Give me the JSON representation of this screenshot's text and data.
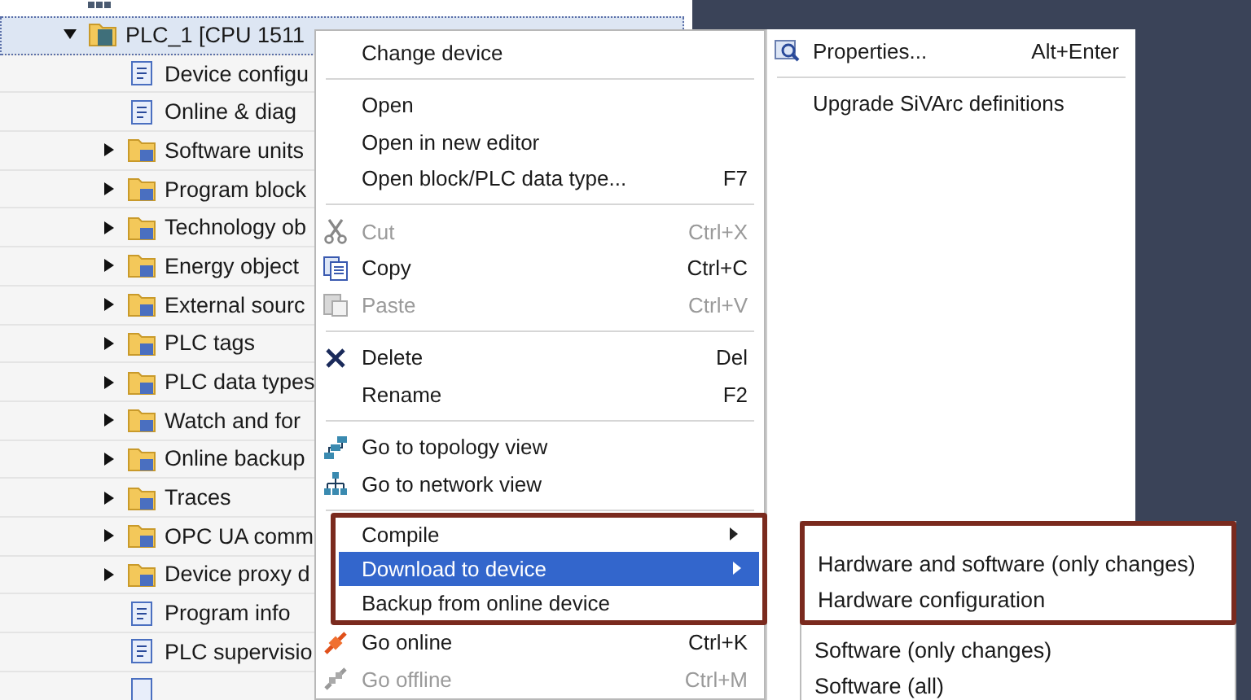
{
  "project_tree": {
    "label": "PLC_1 [CPU 1511",
    "expanded": true,
    "selected": true,
    "children": [
      {
        "label": "Device configu",
        "expandable": false
      },
      {
        "label": "Online & diag",
        "expandable": false
      },
      {
        "label": "Software units",
        "expandable": true
      },
      {
        "label": "Program block",
        "expandable": true
      },
      {
        "label": "Technology ob",
        "expandable": true
      },
      {
        "label": "Energy object",
        "expandable": true
      },
      {
        "label": "External sourc",
        "expandable": true
      },
      {
        "label": "PLC tags",
        "expandable": true
      },
      {
        "label": "PLC data types",
        "expandable": true
      },
      {
        "label": "Watch and for",
        "expandable": true
      },
      {
        "label": "Online backup",
        "expandable": true
      },
      {
        "label": "Traces",
        "expandable": true
      },
      {
        "label": "OPC UA comm",
        "expandable": true
      },
      {
        "label": "Device proxy d",
        "expandable": true
      },
      {
        "label": "Program info",
        "expandable": false
      },
      {
        "label": "PLC supervisio",
        "expandable": false
      }
    ]
  },
  "context_menu": {
    "items": [
      {
        "kind": "item",
        "label": "Change device",
        "disabled": false,
        "selected": false,
        "submenu": false
      },
      {
        "kind": "separator"
      },
      {
        "kind": "item",
        "label": "Open",
        "disabled": false,
        "selected": false,
        "submenu": false
      },
      {
        "kind": "item",
        "label": "Open in new editor",
        "disabled": false,
        "selected": false,
        "submenu": false
      },
      {
        "kind": "item",
        "label": "Open block/PLC data type...",
        "shortcut": "F7",
        "disabled": false,
        "selected": false,
        "submenu": false
      },
      {
        "kind": "separator"
      },
      {
        "kind": "item",
        "label": "Cut",
        "shortcut": "Ctrl+X",
        "disabled": true,
        "selected": false,
        "submenu": false
      },
      {
        "kind": "item",
        "label": "Copy",
        "shortcut": "Ctrl+C",
        "disabled": false,
        "selected": false,
        "submenu": false
      },
      {
        "kind": "item",
        "label": "Paste",
        "shortcut": "Ctrl+V",
        "disabled": true,
        "selected": false,
        "submenu": false
      },
      {
        "kind": "separator"
      },
      {
        "kind": "item",
        "label": "Delete",
        "shortcut": "Del",
        "disabled": false,
        "selected": false,
        "submenu": false
      },
      {
        "kind": "item",
        "label": "Rename",
        "shortcut": "F2",
        "disabled": false,
        "selected": false,
        "submenu": false
      },
      {
        "kind": "separator"
      },
      {
        "kind": "item",
        "label": "Go to topology view",
        "disabled": false,
        "selected": false,
        "submenu": false
      },
      {
        "kind": "item",
        "label": "Go to network view",
        "disabled": false,
        "selected": false,
        "submenu": false
      },
      {
        "kind": "separator"
      },
      {
        "kind": "group",
        "framed": true,
        "items": [
          {
            "label": "Compile",
            "disabled": false,
            "selected": false,
            "submenu": true
          },
          {
            "label": "Download to device",
            "disabled": false,
            "selected": true,
            "submenu": true
          },
          {
            "label": "Backup from online device",
            "disabled": false,
            "selected": false,
            "submenu": false
          }
        ]
      },
      {
        "kind": "item",
        "label": "Go online",
        "shortcut": "Ctrl+K",
        "disabled": false,
        "selected": false,
        "submenu": false
      },
      {
        "kind": "item",
        "label": "Go offline",
        "shortcut": "Ctrl+M",
        "disabled": true,
        "selected": false,
        "submenu": false
      }
    ]
  },
  "side_menu": {
    "items": [
      {
        "kind": "item",
        "label": "Properties...",
        "shortcut": "Alt+Enter"
      },
      {
        "kind": "separator"
      },
      {
        "kind": "item",
        "label": "Upgrade SiVArc definitions"
      }
    ]
  },
  "download_submenu": {
    "framed": true,
    "framed_items": [
      {
        "label": "Hardware and software (only changes)"
      },
      {
        "label": "Hardware configuration"
      }
    ],
    "items": [
      {
        "label": "Software (only changes)"
      },
      {
        "label": "Software (all)"
      }
    ]
  }
}
